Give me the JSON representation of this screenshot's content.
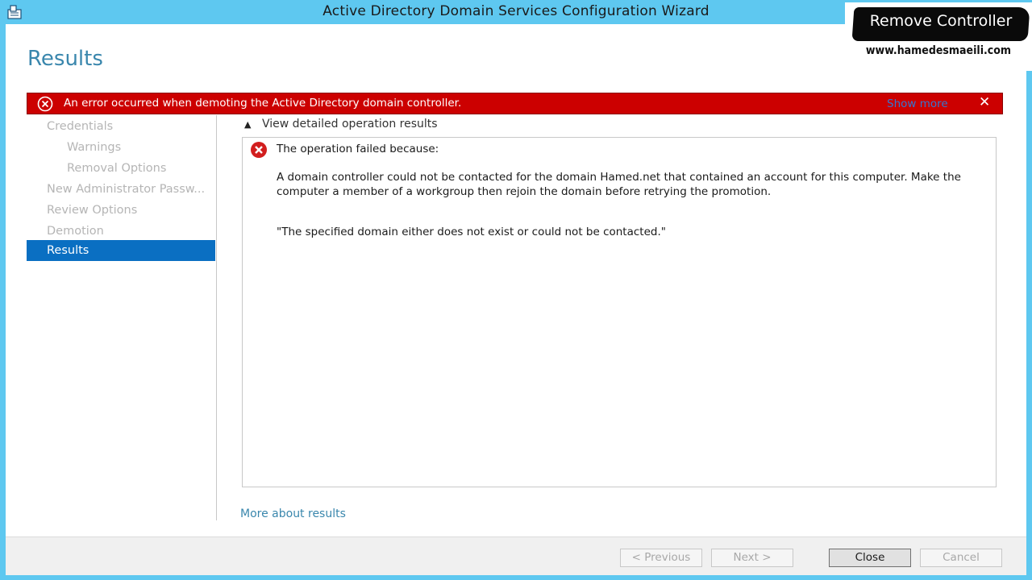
{
  "window": {
    "title": "Active Directory Domain Services Configuration Wizard",
    "page_title": "Results"
  },
  "error_bar": {
    "message": "An error occurred when demoting the Active Directory domain controller.",
    "show_more": "Show more",
    "close": "✕"
  },
  "nav": {
    "items": [
      {
        "label": "Credentials"
      },
      {
        "label": "Warnings"
      },
      {
        "label": "Removal Options"
      },
      {
        "label": "New Administrator Passw..."
      },
      {
        "label": "Review Options"
      },
      {
        "label": "Demotion"
      },
      {
        "label": "Results"
      }
    ]
  },
  "details": {
    "toggle_label": "View detailed operation results",
    "heading": "The operation failed because:",
    "message": "A domain controller could not be contacted for the domain Hamed.net that contained an account for this computer. Make the computer a member of a workgroup then rejoin the domain before retrying the promotion.",
    "quote": "\"The specified domain either does not exist or could not be contacted.\""
  },
  "more_link": "More about results",
  "buttons": {
    "previous": "< Previous",
    "next": "Next >",
    "close": "Close",
    "cancel": "Cancel"
  },
  "watermark": {
    "title": "Remove Controller",
    "url": "www.hamedesmaeili.com"
  },
  "colors": {
    "titlebar": "#5ec8f0",
    "error": "#cc0000",
    "accent": "#0a6fc2",
    "link": "#3a87ad"
  }
}
